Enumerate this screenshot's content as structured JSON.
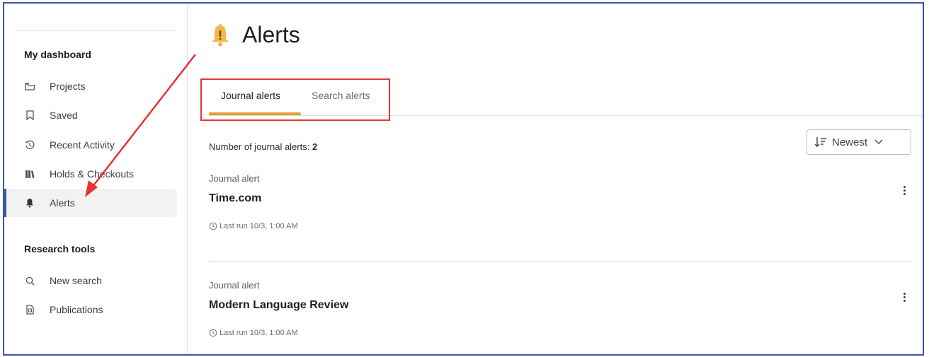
{
  "sidebar": {
    "dashboard_heading": "My dashboard",
    "dashboard_items": [
      {
        "label": "Projects",
        "icon": "folder-icon"
      },
      {
        "label": "Saved",
        "icon": "bookmark-icon"
      },
      {
        "label": "Recent Activity",
        "icon": "history-icon"
      },
      {
        "label": "Holds & Checkouts",
        "icon": "books-icon"
      },
      {
        "label": "Alerts",
        "icon": "bell-icon",
        "active": true
      }
    ],
    "research_heading": "Research tools",
    "research_items": [
      {
        "label": "New search",
        "icon": "search-icon"
      },
      {
        "label": "Publications",
        "icon": "document-icon"
      }
    ]
  },
  "header": {
    "title": "Alerts",
    "icon": "bell-icon",
    "icon_color": "#f0b84d"
  },
  "tabs": [
    {
      "label": "Journal alerts",
      "active": true
    },
    {
      "label": "Search alerts",
      "active": false
    }
  ],
  "summary": {
    "label": "Number of journal alerts:",
    "count": "2"
  },
  "sort": {
    "label": "Newest",
    "icon": "sort-icon"
  },
  "alerts": [
    {
      "type": "Journal alert",
      "name": "Time.com",
      "last_run": "Last run 10/3, 1:00 AM"
    },
    {
      "type": "Journal alert",
      "name": "Modern Language Review",
      "last_run": "Last run 10/3, 1:00 AM"
    }
  ],
  "colors": {
    "accent": "#e0a12c",
    "highlight_box": "#e53535",
    "annotation_arrow": "#e53535",
    "active_border": "#3b56a6"
  }
}
